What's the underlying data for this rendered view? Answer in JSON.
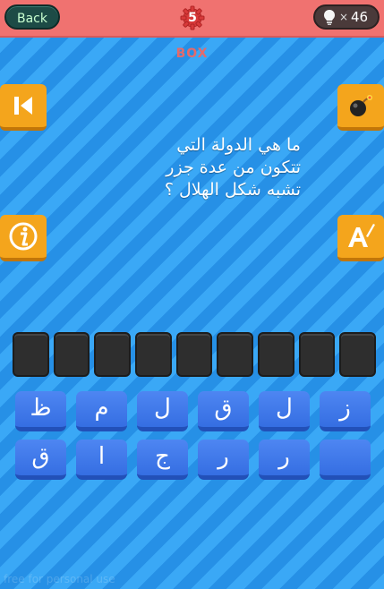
{
  "header": {
    "back_label": "Back",
    "level": "5",
    "hint_count": "46",
    "hint_times": "×"
  },
  "game_label": "BOX",
  "question": {
    "lines": [
      "ما هي الدولة التي",
      "تتكون من عدة جزر",
      "تشبه شكل الهلال ؟"
    ]
  },
  "answer_slots": 9,
  "letters": [
    "ز",
    "ل",
    "ق",
    "ل",
    "م",
    "ظ",
    "",
    "ر",
    "ر",
    "ج",
    "ا",
    "ق"
  ],
  "icons": {
    "left_top": "skip-back-icon",
    "right_top": "bomb-icon",
    "left_mid": "info-icon",
    "right_mid": "reveal-letter-icon",
    "hint": "lightbulb-icon"
  },
  "colors": {
    "topbar": "#f07270",
    "background": "#2f9ef0",
    "side_button": "#f4a51c",
    "letter_key": "#4579ea",
    "slot": "#2e2e2e"
  },
  "watermark": "free for personal use"
}
